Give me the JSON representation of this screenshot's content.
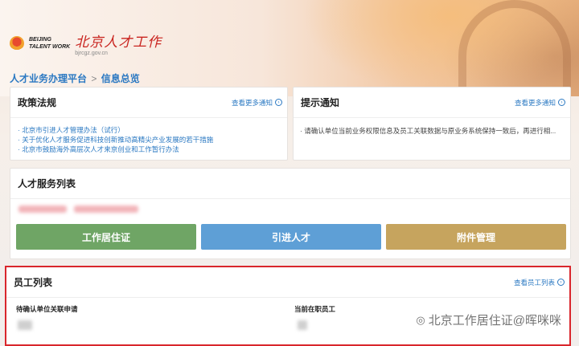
{
  "header": {
    "logo_en_1": "BEIJING",
    "logo_en_2": "TALENT WORK",
    "logo_cn": "北京人才工作",
    "logo_url": "bjrcgz.gov.cn"
  },
  "breadcrumb": {
    "root": "人才业务办理平台",
    "separator": ">",
    "current": "信息总览"
  },
  "policy": {
    "title": "政策法规",
    "more": "查看更多通知",
    "items": [
      "北京市引进人才管理办法（试行）",
      "关于优化人才服务促进科技创新推动高精尖产业发展的若干措施",
      "北京市鼓励海外高层次人才来京创业和工作暂行办法"
    ]
  },
  "notice": {
    "title": "提示通知",
    "more": "查看更多通知",
    "text": "请确认单位当前业务权限信息及员工关联数据与原业务系统保持一致后，再进行相..."
  },
  "services": {
    "title": "人才服务列表",
    "buttons": [
      {
        "label": "工作居住证",
        "color": "#6fa565"
      },
      {
        "label": "引进人才",
        "color": "#5e9fd6"
      },
      {
        "label": "附件管理",
        "color": "#c6a45e"
      }
    ]
  },
  "employees": {
    "title": "员工列表",
    "more": "查看员工列表",
    "pending_label": "待确认单位关联申请",
    "current_label": "当前在职员工"
  },
  "watermark": {
    "text": "北京工作居住证@晖咪咪"
  },
  "icons": {
    "more": "chevron-circle-right-icon",
    "watermark": "wechat-icon"
  }
}
